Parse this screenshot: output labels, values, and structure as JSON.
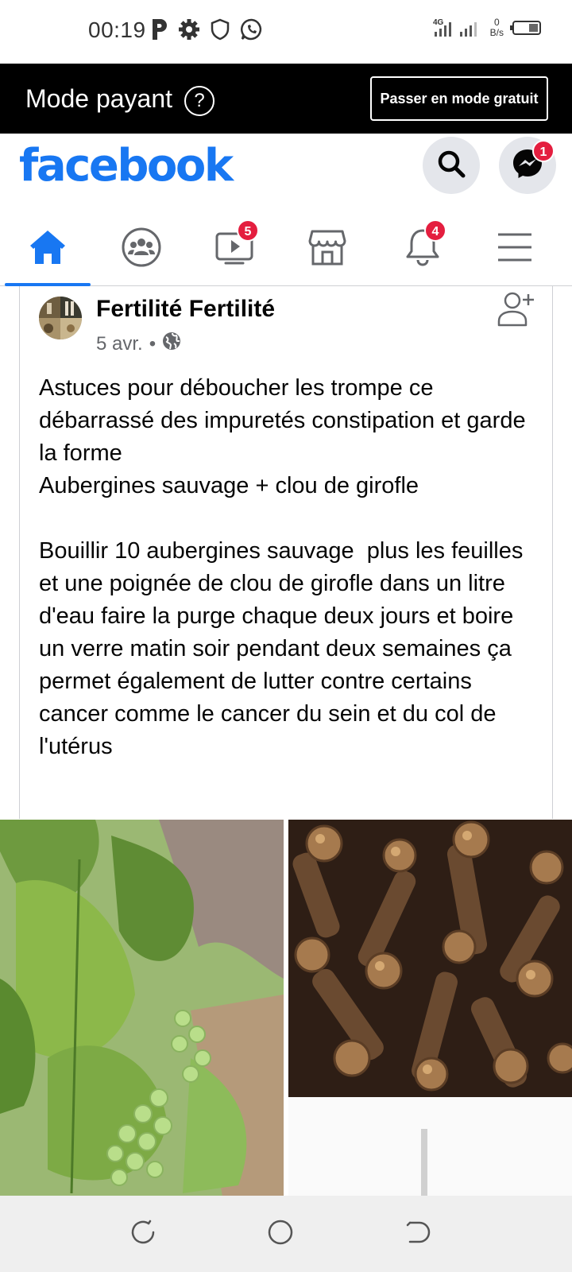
{
  "status_bar": {
    "time": "00:19",
    "network_type": "4G",
    "speed_value": "0",
    "speed_unit": "B/s",
    "icons": [
      "parking-icon",
      "settings-icon",
      "shield-icon",
      "whatsapp-icon",
      "signal-icon",
      "battery-icon"
    ]
  },
  "paid_mode": {
    "label": "Mode payant",
    "help_symbol": "?",
    "switch_button": "Passer en mode gratuit"
  },
  "header": {
    "logo": "facebook",
    "messenger_badge": "1"
  },
  "nav": {
    "tabs": [
      {
        "name": "home",
        "active": true,
        "badge": ""
      },
      {
        "name": "groups",
        "active": false,
        "badge": ""
      },
      {
        "name": "watch",
        "active": false,
        "badge": "5"
      },
      {
        "name": "marketplace",
        "active": false,
        "badge": ""
      },
      {
        "name": "notifications",
        "active": false,
        "badge": "4"
      },
      {
        "name": "menu",
        "active": false,
        "badge": ""
      }
    ],
    "watch_badge": "5",
    "notifications_badge": "4"
  },
  "post": {
    "author": "Fertilité Fertilité",
    "date": "5 avr.",
    "separator": "•",
    "body": "Astuces pour déboucher les trompe ce débarrassé des impuretés constipation et garde la forme\nAubergines sauvage + clou de girofle\n\nBouillir 10 aubergines sauvage  plus les feuilles et une poignée de clou de girofle dans un litre d'eau faire la purge chaque deux jours et boire un verre matin soir pendant deux semaines ça permet également de lutter contre certains cancer comme le cancer du sein et du col de l'utérus"
  },
  "colors": {
    "brand": "#1877f2",
    "badge": "#e41e3f",
    "paid_bar": "#000000"
  }
}
